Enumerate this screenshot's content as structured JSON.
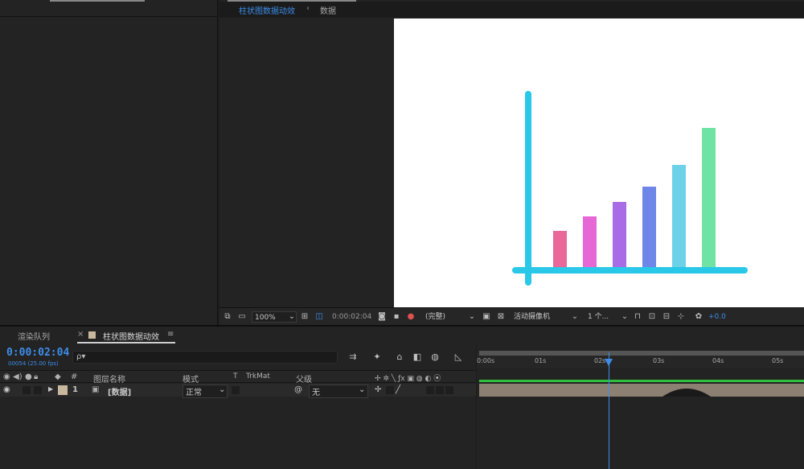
{
  "viewer": {
    "tabs": [
      {
        "label": "柱状图数据动效",
        "active": true
      },
      {
        "label": "数据",
        "active": false
      }
    ]
  },
  "chart": {
    "axis_color": "#29c8e8",
    "bars": [
      {
        "value": 45,
        "color": "#e9679a"
      },
      {
        "value": 63,
        "color": "#e668d6"
      },
      {
        "value": 81,
        "color": "#a86ce6"
      },
      {
        "value": 100,
        "color": "#6e86e8"
      },
      {
        "value": 127,
        "color": "#6dd1e8"
      },
      {
        "value": 173,
        "color": "#6fe3a3"
      }
    ]
  },
  "viewer_toolbar": {
    "zoom": "100%",
    "timecode": "0:00:02:04",
    "resolution": "(完整)",
    "camera": "活动摄像机",
    "views": "1 个...",
    "exposure": "+0.0"
  },
  "bottom_tabs": [
    {
      "label": "渲染队列"
    },
    {
      "label": "柱状图数据动效",
      "active": true
    }
  ],
  "timeline": {
    "timecode": "0:00:02:04",
    "fps_label": "00054 (25.00 fps)",
    "search_placeholder": "ρ▾",
    "columns": {
      "num": "#",
      "name": "图层名称",
      "mode": "模式",
      "t": "T",
      "trkmat": "TrkMat",
      "parent": "父级"
    },
    "layer": {
      "num": "1",
      "name": "[数据]",
      "mode": "正常",
      "parent": "无"
    },
    "ruler_ticks": [
      "0:00s",
      "01s",
      "02s",
      "03s",
      "04s",
      "05s"
    ]
  }
}
